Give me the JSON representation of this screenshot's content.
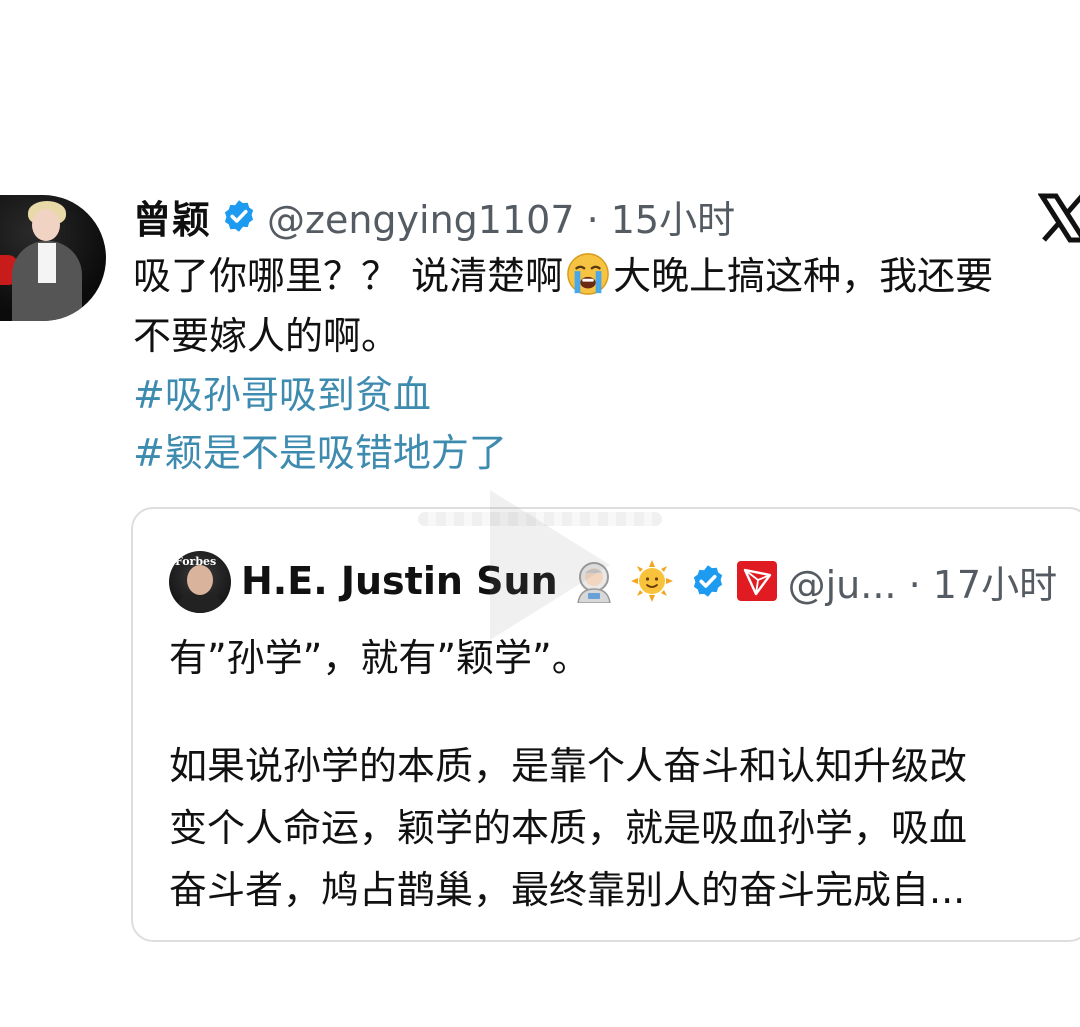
{
  "main_tweet": {
    "display_name": "曾颖",
    "handle_time": "@zengying1107 · 15小时",
    "text_lines": [
      "吸了你哪里？？ 说清楚啊",
      "大晚上搞这种，我还要",
      "不要嫁人的啊。"
    ],
    "hashtags": [
      "#吸孙哥吸到贫血",
      "#颖是不是吸错地方了"
    ],
    "icons": {
      "verified": "verified-badge-icon",
      "emoji": "loudly-crying-face-icon",
      "brand": "x-logo-icon"
    }
  },
  "quoted_tweet": {
    "display_name": "H.E. Justin Sun",
    "handle_time": "@ju... · 17小时",
    "avatar_text": "Forbes",
    "icons": [
      "astronaut-emoji-icon",
      "sun-face-emoji-icon",
      "verified-badge-icon",
      "tron-logo-icon"
    ],
    "text_lines_1": [
      "有”孙学”，就有”颖学”。"
    ],
    "text_lines_2": [
      "如果说孙学的本质，是靠个人奋斗和认知升级改",
      "变个人命运，颖学的本质，就是吸血孙学，吸血",
      "奋斗者，鸠占鹊巢，最终靠别人的奋斗完成自..."
    ]
  },
  "colors": {
    "hashtag": "#3e8bb0",
    "verified": "#1d9bf0",
    "handle": "#555b62",
    "tron": "#e11b22"
  }
}
